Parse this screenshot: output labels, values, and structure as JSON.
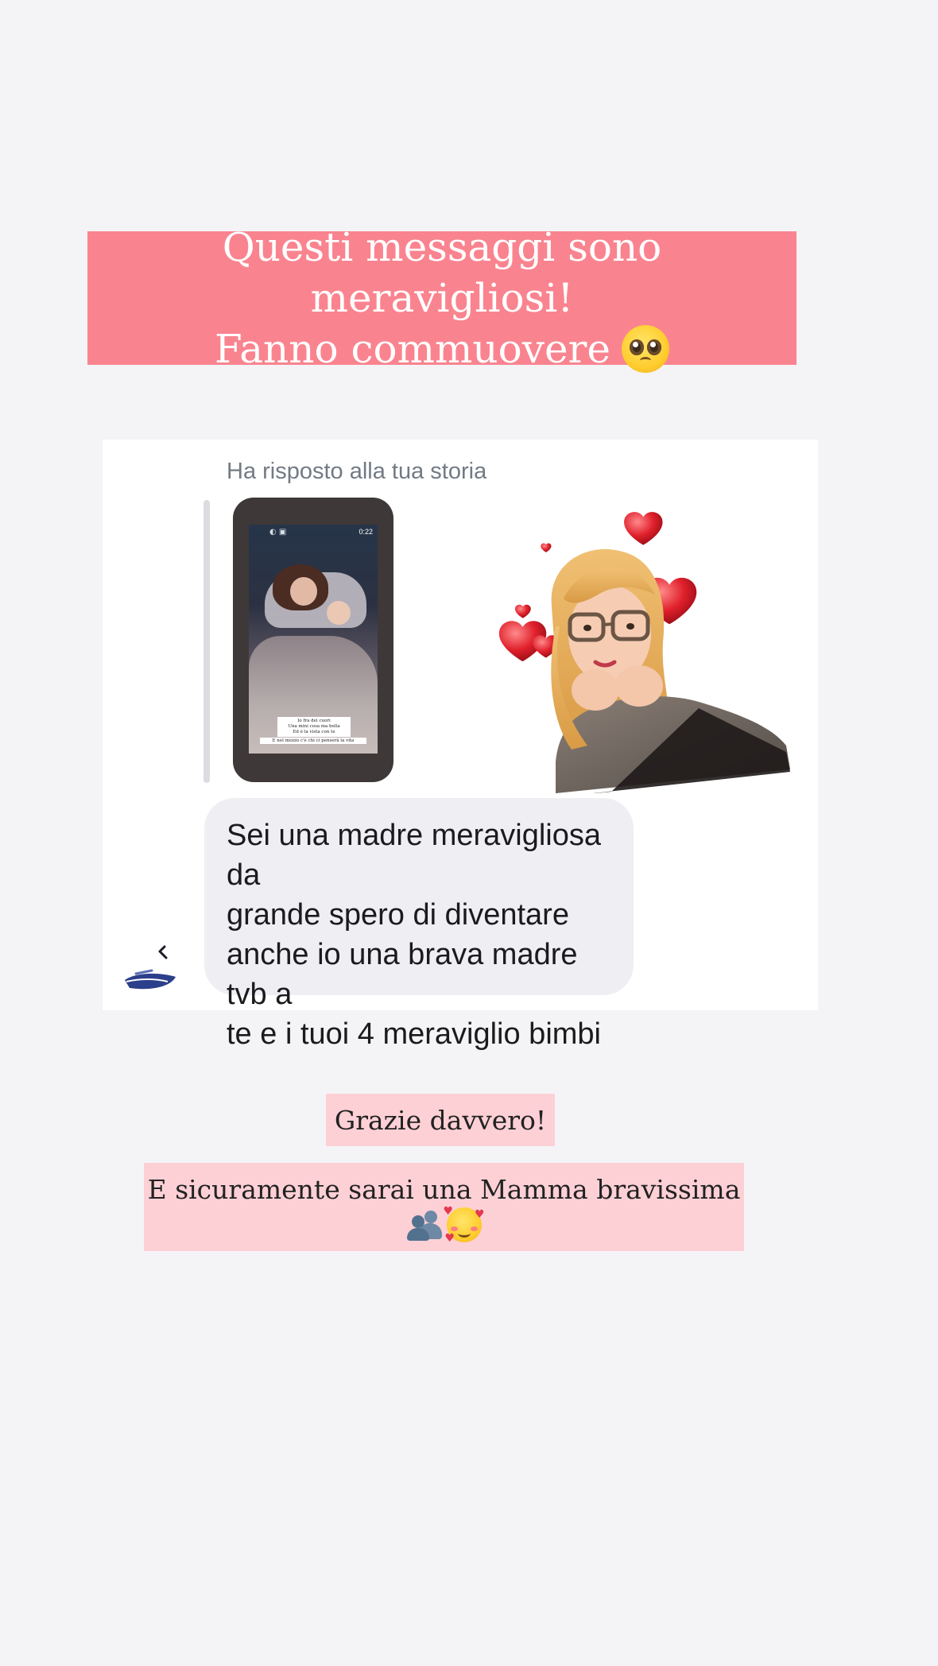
{
  "top_caption": {
    "line1": "Questi messaggi sono meravigliosi!",
    "line2": "Fanno commuovere",
    "emoji": "pleading-face-emoji",
    "background": "#f9848f"
  },
  "chat": {
    "replied_label": "Ha risposto alla tua storia",
    "story_preview": {
      "time": "0:22",
      "caption_lines": [
        "Io fra dei cuori",
        "Una mini cosa ma bella",
        "Ed è la vista con te"
      ],
      "caption_bottom": "E nel mezzo c'è chi ci penserà la vita"
    },
    "sticker": "memoji-hearts-sticker",
    "message": "Sei una madre meravigliosa   da\ngrande spero di diventare\nanche io una brava madre tvb a\nte e i tuoi 4 meraviglio bimbi",
    "bubble_color": "#efeff3"
  },
  "replies": {
    "thanks": "Grazie davvero!",
    "mamma": "E sicuramente sarai una Mamma bravissima",
    "mamma_emojis": [
      "busts-in-silhouette-emoji",
      "smiling-face-with-hearts-emoji"
    ],
    "background": "#fdd0d5"
  }
}
